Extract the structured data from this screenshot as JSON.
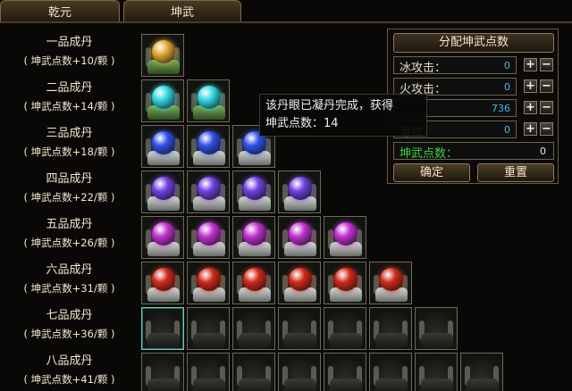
{
  "tabs": [
    {
      "label": "乾元"
    },
    {
      "label": "坤武"
    }
  ],
  "rows": [
    {
      "name": "一品成丹",
      "points": "( 坤武点数+10/颗 )",
      "filled": 1,
      "color": "gold"
    },
    {
      "name": "二品成丹",
      "points": "( 坤武点数+14/颗 )",
      "filled": 2,
      "color": "cyan"
    },
    {
      "name": "三品成丹",
      "points": "( 坤武点数+18/颗 )",
      "filled": 3,
      "color": "blue"
    },
    {
      "name": "四品成丹",
      "points": "( 坤武点数+22/颗 )",
      "filled": 4,
      "color": "violet"
    },
    {
      "name": "五品成丹",
      "points": "( 坤武点数+26/颗 )",
      "filled": 5,
      "color": "magenta"
    },
    {
      "name": "六品成丹",
      "points": "( 坤武点数+31/颗 )",
      "filled": 6,
      "color": "red"
    },
    {
      "name": "七品成丹",
      "points": "( 坤武点数+36/颗 )",
      "filled": 0,
      "color": "empty"
    },
    {
      "name": "八品成丹",
      "points": "( 坤武点数+41/颗 )",
      "filled": 0,
      "color": "empty"
    }
  ],
  "panel": {
    "title": "分配坤武点数",
    "stats": [
      {
        "label": "冰攻击：",
        "value": "0"
      },
      {
        "label": "火攻击：",
        "value": "0"
      },
      {
        "label": "",
        "value": "736"
      },
      {
        "label": "毒攻",
        "value": "0"
      }
    ],
    "total_label": "坤武点数：",
    "total_value": "0",
    "confirm_label": "确定",
    "reset_label": "重置"
  },
  "tooltip": {
    "line1": "该丹眼已凝丹完成，获得",
    "line2": "坤武点数：14"
  },
  "colors": {
    "gold": "#e0a830",
    "cyan": "#30d8e0",
    "blue": "#3050e8",
    "violet": "#7040e0",
    "magenta": "#c030d0",
    "red": "#d02818"
  }
}
